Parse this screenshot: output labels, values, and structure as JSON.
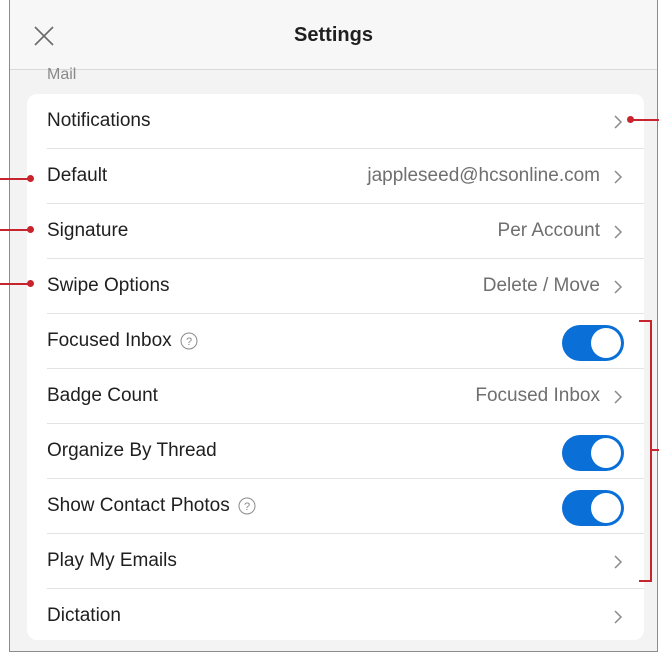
{
  "header": {
    "title": "Settings",
    "close_icon": "close-icon"
  },
  "section": {
    "label": "Mail"
  },
  "rows": [
    {
      "label": "Notifications",
      "value": "",
      "control": "chevron"
    },
    {
      "label": "Default",
      "value": "jappleseed@hcsonline.com",
      "control": "chevron"
    },
    {
      "label": "Signature",
      "value": "Per Account",
      "control": "chevron"
    },
    {
      "label": "Swipe Options",
      "value": "Delete / Move",
      "control": "chevron"
    },
    {
      "label": "Focused Inbox",
      "value": "",
      "control": "toggle",
      "on": true,
      "help": true
    },
    {
      "label": "Badge Count",
      "value": "Focused Inbox",
      "control": "chevron"
    },
    {
      "label": "Organize By Thread",
      "value": "",
      "control": "toggle",
      "on": true
    },
    {
      "label": "Show Contact Photos",
      "value": "",
      "control": "toggle",
      "on": true,
      "help": true
    },
    {
      "label": "Play My Emails",
      "value": "",
      "control": "chevron"
    },
    {
      "label": "Dictation",
      "value": "",
      "control": "chevron"
    }
  ],
  "colors": {
    "accent": "#0a6fd6",
    "callout": "#c8242d",
    "background": "#f3f3f3"
  }
}
